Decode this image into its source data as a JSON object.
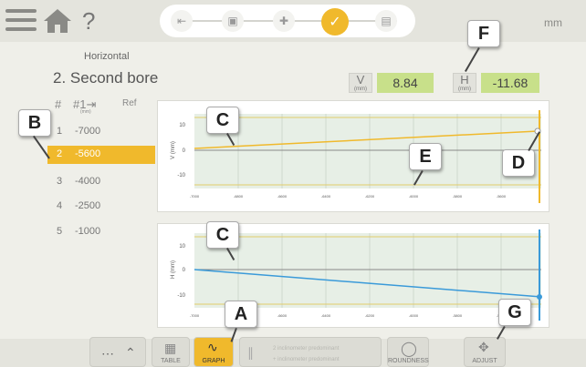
{
  "header": {
    "help_glyph": "?",
    "unit": "mm",
    "steps": [
      "distances-icon",
      "sensor-icon",
      "center-icon",
      "measure-icon",
      "results-icon"
    ],
    "active_step": 3
  },
  "main": {
    "mode": "Horizontal",
    "title": "2. Second bore",
    "readouts": [
      {
        "axis": "V",
        "unit": "(mm)",
        "value": "8.84"
      },
      {
        "axis": "H",
        "unit": "(mm)",
        "value": "-11.68"
      }
    ]
  },
  "table": {
    "columns": [
      "#",
      "#1⇥",
      "Ref"
    ],
    "column_sub": "(mm)",
    "rows": [
      {
        "n": "1",
        "value": "-7000"
      },
      {
        "n": "2",
        "value": "-5600"
      },
      {
        "n": "3",
        "value": "-4000"
      },
      {
        "n": "4",
        "value": "-2500"
      },
      {
        "n": "5",
        "value": "-1000"
      }
    ],
    "selected_row": 1
  },
  "plots": [
    {
      "ylabel": "V (mm)",
      "yticks": [
        "10",
        "0",
        "-10"
      ],
      "xticks": [
        "-7000",
        "-6800",
        "-6600",
        "-6400",
        "-6200",
        "-6000",
        "-5800",
        "-5600"
      ]
    },
    {
      "ylabel": "H (mm)",
      "yticks": [
        "10",
        "0",
        "-10"
      ],
      "xticks": [
        "-7000",
        "-6600",
        "-6400",
        "-6200",
        "-6000",
        "-5800",
        "-5600"
      ]
    }
  ],
  "callouts": {
    "a": "A",
    "b": "B",
    "c1": "C",
    "c2": "C",
    "d": "D",
    "e": "E",
    "f": "F",
    "g": "G"
  },
  "bottom": {
    "table_label": "TABLE",
    "graph_label": "GRAPH",
    "filter_label_1": "2 inclinometer predominant",
    "filter_label_2": "+ inclinometer predominant",
    "roundness_label": "ROUNDNESS",
    "adjust_label": "ADJUST"
  },
  "colors": {
    "accent": "#f0b92c",
    "readout": "#c8e08a",
    "v_line": "#f0b92c",
    "h_line": "#3a9ad9"
  }
}
